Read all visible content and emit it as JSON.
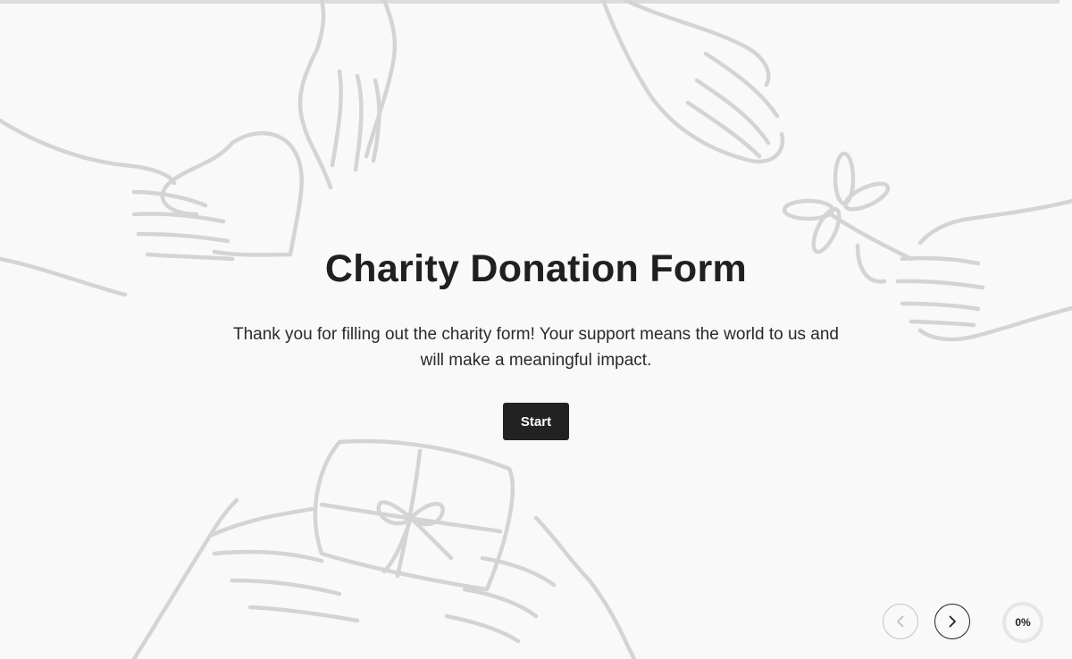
{
  "form": {
    "title": "Charity Donation Form",
    "description": "Thank you for filling out the charity form! Your support means the world to us and will make a meaningful impact.",
    "start_label": "Start"
  },
  "navigation": {
    "prev_icon": "chevron-left-icon",
    "next_icon": "chevron-right-icon",
    "prev_enabled": false,
    "next_enabled": true
  },
  "progress": {
    "value": 0,
    "label": "0%"
  },
  "colors": {
    "background": "#f9f9f9",
    "text": "#202020",
    "button": "#222222",
    "illustration": "#d4d4d4"
  }
}
